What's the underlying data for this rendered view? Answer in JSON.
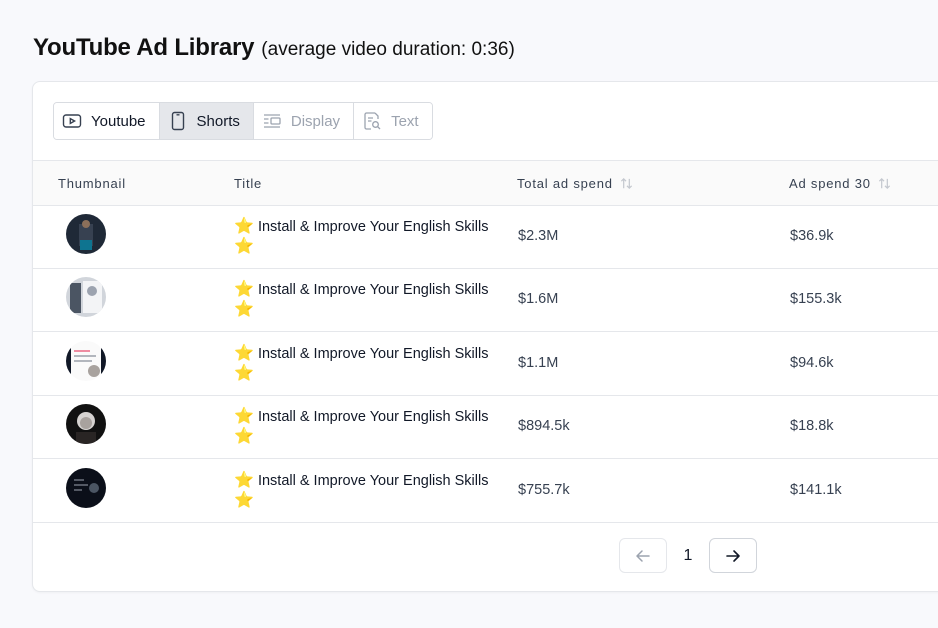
{
  "page": {
    "title": "YouTube Ad Library",
    "subtitle": "(average video duration: 0:36)"
  },
  "tabs": [
    {
      "label": "Youtube",
      "icon": "play-icon",
      "state": "normal"
    },
    {
      "label": "Shorts",
      "icon": "phone-icon",
      "state": "active"
    },
    {
      "label": "Display",
      "icon": "display-icon",
      "state": "disabled"
    },
    {
      "label": "Text",
      "icon": "text-search-icon",
      "state": "disabled"
    }
  ],
  "table": {
    "columns": [
      "Thumbnail",
      "Title",
      "Total ad spend",
      "Ad spend 30"
    ],
    "rows": [
      {
        "title": "Install & Improve Your English Skills",
        "total_spend": "$2.3M",
        "spend_30": "$36.9k",
        "star": "⭐"
      },
      {
        "title": "Install & Improve Your English Skills",
        "total_spend": "$1.6M",
        "spend_30": "$155.3k",
        "star": "⭐"
      },
      {
        "title": "Install & Improve Your English Skills",
        "total_spend": "$1.1M",
        "spend_30": "$94.6k",
        "star": "⭐"
      },
      {
        "title": "Install & Improve Your English Skills",
        "total_spend": "$894.5k",
        "spend_30": "$18.8k",
        "star": "⭐"
      },
      {
        "title": "Install & Improve Your English Skills",
        "total_spend": "$755.7k",
        "spend_30": "$141.1k",
        "star": "⭐"
      }
    ]
  },
  "pagination": {
    "current_page": "1"
  },
  "colors": {
    "background": "#f8f9fc",
    "active_tab": "#e5e7eb",
    "star": "#f5b301"
  }
}
